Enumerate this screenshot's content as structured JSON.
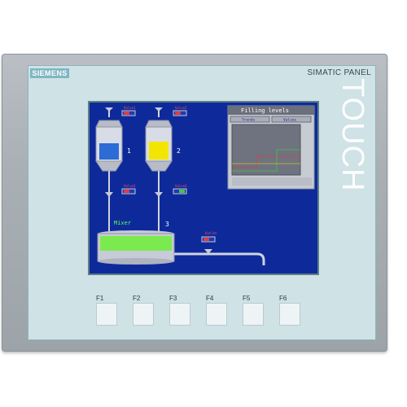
{
  "device": {
    "brand": "SIEMENS",
    "model_label": "SIMATIC PANEL",
    "vertical_label": "TOUCH"
  },
  "screen": {
    "valves": [
      "Valve1",
      "Valve2",
      "Valve3",
      "Valve4"
    ],
    "tank_numbers": [
      "1",
      "2",
      "3"
    ],
    "mixer_label": "Mixer",
    "outlet_label": "Outlet",
    "trend_window": {
      "title": "Filling levels",
      "tabs": [
        "Trends",
        "Values"
      ]
    }
  },
  "function_keys": [
    "F1",
    "F2",
    "F3",
    "F4",
    "F5",
    "F6"
  ],
  "colors": {
    "screen_bg": "#0e2a9a",
    "tank1_fill": "#2d6bd6",
    "tank2_fill": "#f2e600",
    "mixer_fill": "#7bea4e",
    "bezel_accent": "#7fb7c2"
  }
}
